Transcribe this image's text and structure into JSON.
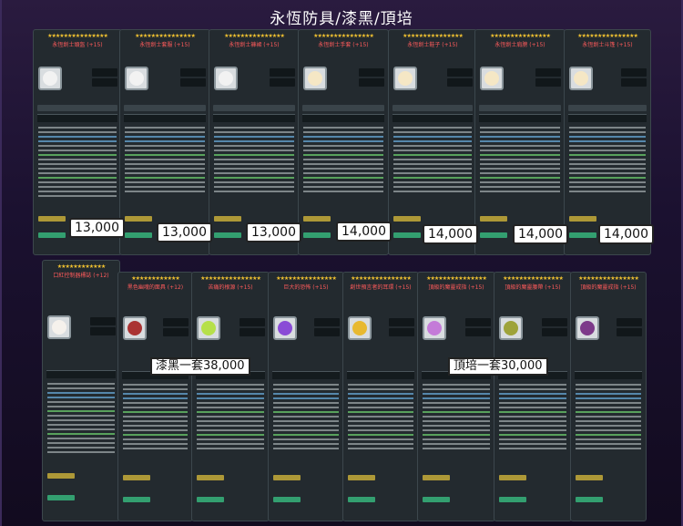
{
  "title": "永恆防具/漆黑/頂培",
  "top_row": [
    {
      "name": "永恆劍士頭盔 (+15)",
      "price": "13,000",
      "color": "#f2f2f2"
    },
    {
      "name": "永恆劍士套服 (+15)",
      "price": "13,000",
      "color": "#f2f2f2"
    },
    {
      "name": "永恆劍士褲裙 (+15)",
      "price": "13,000",
      "color": "#f2f2f2"
    },
    {
      "name": "永恆劍士手套 (+15)",
      "price": "14,000",
      "color": "#f5e7c5"
    },
    {
      "name": "永恆劍士鞋子 (+15)",
      "price": "14,000",
      "color": "#f5e7c5"
    },
    {
      "name": "永恆劍士肩膀 (+15)",
      "price": "14,000",
      "color": "#f5e7c5"
    },
    {
      "name": "永恆劍士斗篷 (+15)",
      "price": "14,000",
      "color": "#f5e7c5"
    }
  ],
  "bottom_row": [
    {
      "name": "口紅控制器標誌 (+12)",
      "color": "#f5f1ec"
    },
    {
      "name": "黑色幽魂的面具 (+12)",
      "color": "#a33"
    },
    {
      "name": "苦痛的根源 (+15)",
      "color": "#b6e04a"
    },
    {
      "name": "巨大的恐怖 (+15)",
      "color": "#8a4bd6"
    },
    {
      "name": "創世預言者的耳環 (+15)",
      "color": "#e8b930"
    },
    {
      "name": "頂級的魔靈戒指 (+15)",
      "color": "#c47bd8"
    },
    {
      "name": "頂級的魔靈腰帶 (+15)",
      "color": "#9ea33a"
    },
    {
      "name": "頂級的魔靈戒指 (+15)",
      "color": "#7d3a8a"
    }
  ],
  "banners": {
    "black_set": "漆黑一套38,000",
    "top_set": "頂培一套30,000"
  },
  "colors": {
    "background": "#150d22",
    "card": "#232a2f",
    "stars": "#f2c230",
    "item_name": "#ff5b5b"
  }
}
